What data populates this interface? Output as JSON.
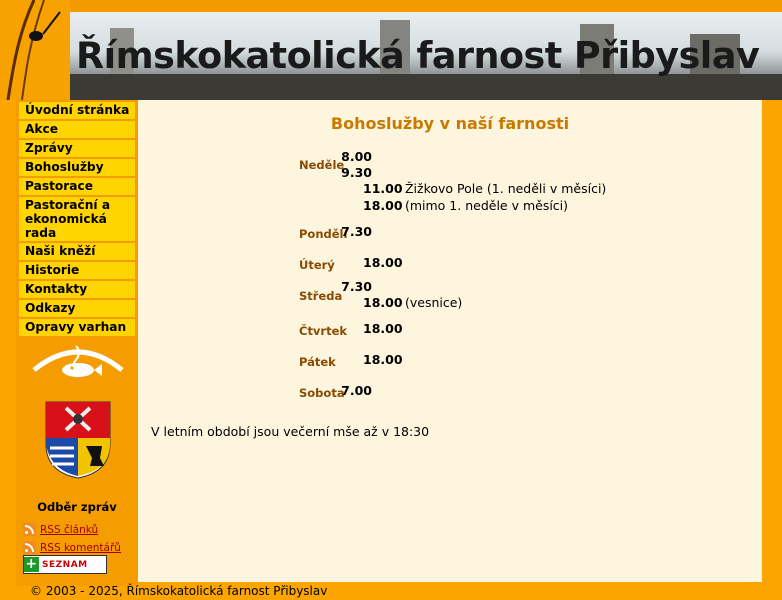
{
  "header": {
    "site_title": "Římskokatolická farnost Přibyslav"
  },
  "sidebar": {
    "menu": [
      {
        "label": "Úvodní stránka"
      },
      {
        "label": "Akce"
      },
      {
        "label": "Zprávy"
      },
      {
        "label": "Bohoslužby"
      },
      {
        "label": "Pastorace"
      },
      {
        "label_line1": "Pastorační a",
        "label_line2": "ekonomická rada"
      },
      {
        "label": "Naši kněží"
      },
      {
        "label": "Historie"
      },
      {
        "label": "Kontakty"
      },
      {
        "label": "Odkazy"
      },
      {
        "label": "Opravy varhan"
      }
    ],
    "feeds_title": "Odběr zpráv",
    "feeds": [
      {
        "label": "RSS článků",
        "icon": "rss-icon"
      },
      {
        "label": "RSS komentářů",
        "icon": "rss-icon"
      }
    ],
    "seznam_label": "SEZNAM"
  },
  "main": {
    "title": "Bohoslužby v naší farnosti",
    "schedule": [
      {
        "day": "Neděle",
        "times": [
          {
            "time": "8.00",
            "note": ""
          },
          {
            "time": "9.30",
            "note": ""
          },
          {
            "time": "11.00",
            "note": "Žižkovo Pole (1. neděli v měsíci)"
          },
          {
            "time": "18.00",
            "note": "(mimo 1. neděle v měsíci)"
          }
        ]
      },
      {
        "day": "Pondělí",
        "times": [
          {
            "time": "7.30",
            "note": ""
          }
        ]
      },
      {
        "day": "Úterý",
        "times": [
          {
            "time": "18.00",
            "note": ""
          }
        ]
      },
      {
        "day": "Středa",
        "times": [
          {
            "time": "7.30",
            "note": ""
          },
          {
            "time": "18.00",
            "note": "(vesnice)"
          }
        ]
      },
      {
        "day": "Čtvrtek",
        "times": [
          {
            "time": "18.00",
            "note": ""
          }
        ]
      },
      {
        "day": "Pátek",
        "times": [
          {
            "time": "18.00",
            "note": ""
          }
        ]
      },
      {
        "day": "Sobota",
        "times": [
          {
            "time": "7.00",
            "note": ""
          }
        ]
      }
    ],
    "summer_note": "V letním období jsou večerní mše až v 18:30"
  },
  "footer": {
    "copyright": "© 2003 - 2025, Římskokatolická farnost Přibyslav"
  },
  "colors": {
    "background": "#fca500",
    "menu_item": "#ffd400",
    "content_bg": "#fdf5de",
    "title": "#c87a00",
    "day_label": "#8a4a00"
  }
}
